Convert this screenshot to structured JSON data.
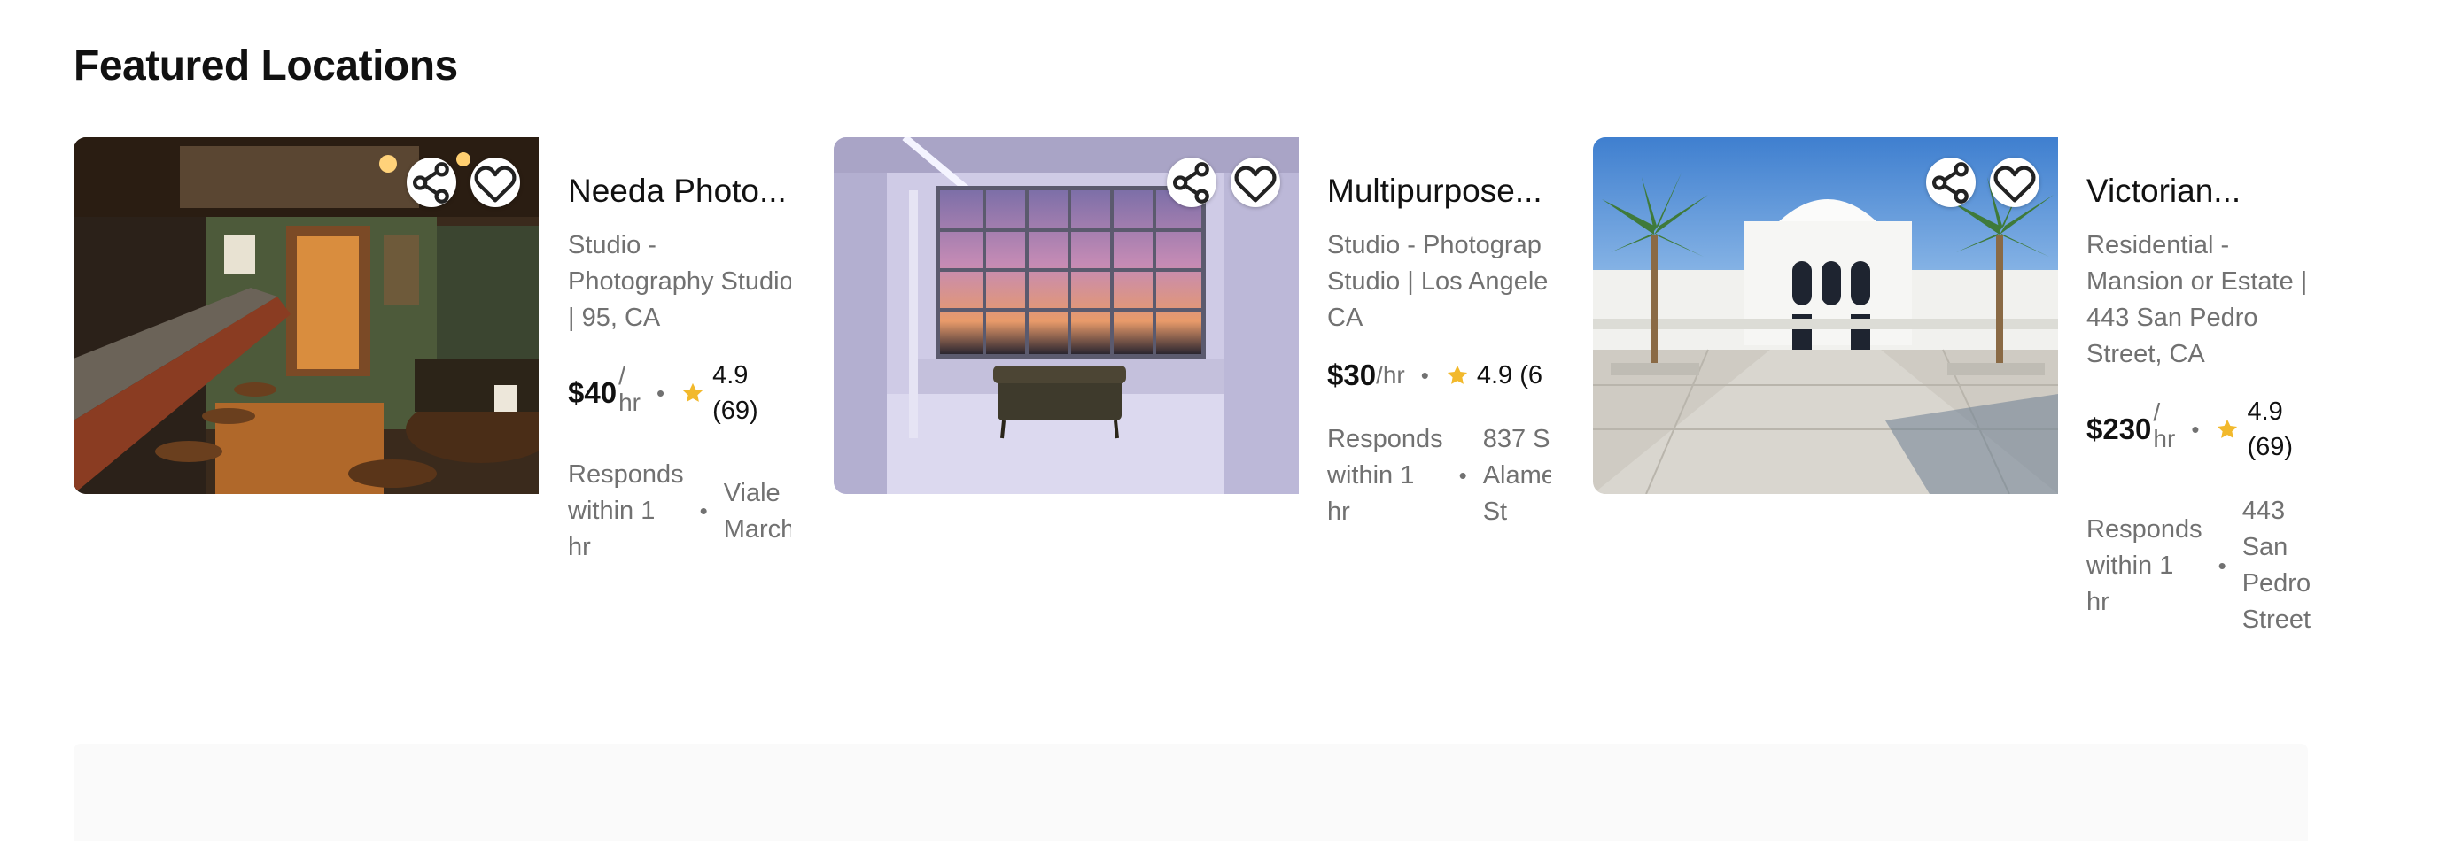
{
  "section": {
    "title": "Featured Locations"
  },
  "cards": [
    {
      "name": "Needa Photo...",
      "type_lines": [
        "Studio -",
        "Photography Studio",
        "| 95, CA"
      ],
      "price": "$40",
      "per_unit": "/",
      "per_unit2": "hr",
      "rating_lines": [
        "4.9",
        "(69)"
      ],
      "response_lines": [
        "Responds",
        "within 1",
        "hr"
      ],
      "address_lines": [
        "Viale",
        "March"
      ]
    },
    {
      "name": "Multipurpose...",
      "type_lines": [
        "Studio - Photograp",
        "Studio | Los Angele",
        "CA"
      ],
      "price": "$30",
      "per_unit": "/hr",
      "rating": "4.9 (6",
      "response_lines": [
        "Responds",
        "within 1",
        "hr"
      ],
      "address_lines": [
        "837 S",
        "Alame",
        "St"
      ]
    },
    {
      "name": "Victorian...",
      "type_lines": [
        "Residential -",
        "Mansion or Estate |",
        "443 San Pedro",
        "Street, CA"
      ],
      "price": "$230",
      "per_unit": "/",
      "per_unit2": "hr",
      "rating_lines": [
        "4.9",
        "(69)"
      ],
      "response_lines": [
        "Responds",
        "within 1",
        "hr"
      ],
      "address_lines": [
        "443",
        "San",
        "Pedro",
        "Street"
      ]
    }
  ],
  "icons": {
    "share": "share-icon",
    "favorite": "heart-icon",
    "star": "star-icon"
  },
  "colors": {
    "star": "#F2B92C",
    "muted_text": "#717171",
    "panel": "#FAFAFA"
  }
}
